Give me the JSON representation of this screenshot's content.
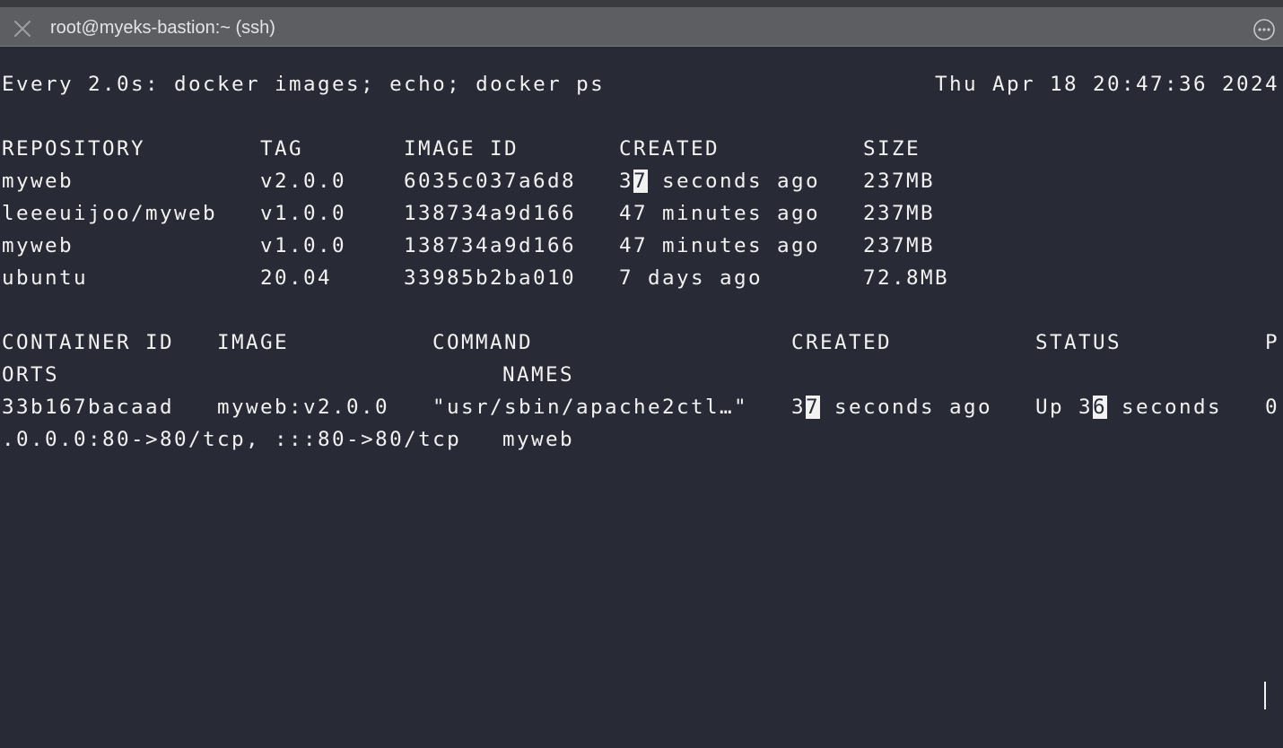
{
  "window": {
    "title": "root@myeks-bastion:~ (ssh)",
    "close_icon": "close-icon",
    "more_icon": "more-options-icon"
  },
  "header": {
    "command": "Every 2.0s: docker images; echo; docker ps",
    "timestamp": "Thu Apr 18 20:47:36 2024"
  },
  "images": {
    "headers": {
      "repository": "REPOSITORY",
      "tag": "TAG",
      "image_id": "IMAGE ID",
      "created": "CREATED",
      "size": "SIZE"
    },
    "rows": [
      {
        "repository": "myweb",
        "tag": "v2.0.0",
        "image_id": "6035c037a6d8",
        "created": "37 seconds ago",
        "size": "237MB"
      },
      {
        "repository": "leeeuijoo/myweb",
        "tag": "v1.0.0",
        "image_id": "138734a9d166",
        "created": "47 minutes ago",
        "size": "237MB"
      },
      {
        "repository": "myweb",
        "tag": "v1.0.0",
        "image_id": "138734a9d166",
        "created": "47 minutes ago",
        "size": "237MB"
      },
      {
        "repository": "ubuntu",
        "tag": "20.04",
        "image_id": "33985b2ba010",
        "created": "7 days ago",
        "size": "72.8MB"
      }
    ]
  },
  "containers": {
    "headers": {
      "container_id": "CONTAINER ID",
      "image": "IMAGE",
      "command": "COMMAND",
      "created": "CREATED",
      "status": "STATUS",
      "ports_start": "P",
      "ports_rest": "ORTS",
      "names": "NAMES"
    },
    "rows": [
      {
        "container_id": "33b167bacaad",
        "image": "myweb:v2.0.0",
        "command": "\"usr/sbin/apache2ctl…\"",
        "created": "37 seconds ago",
        "status": "Up 36 seconds",
        "ports_start": "0",
        "ports_rest": ".0.0.0:80->80/tcp, :::80->80/tcp",
        "names": "myweb"
      }
    ]
  }
}
